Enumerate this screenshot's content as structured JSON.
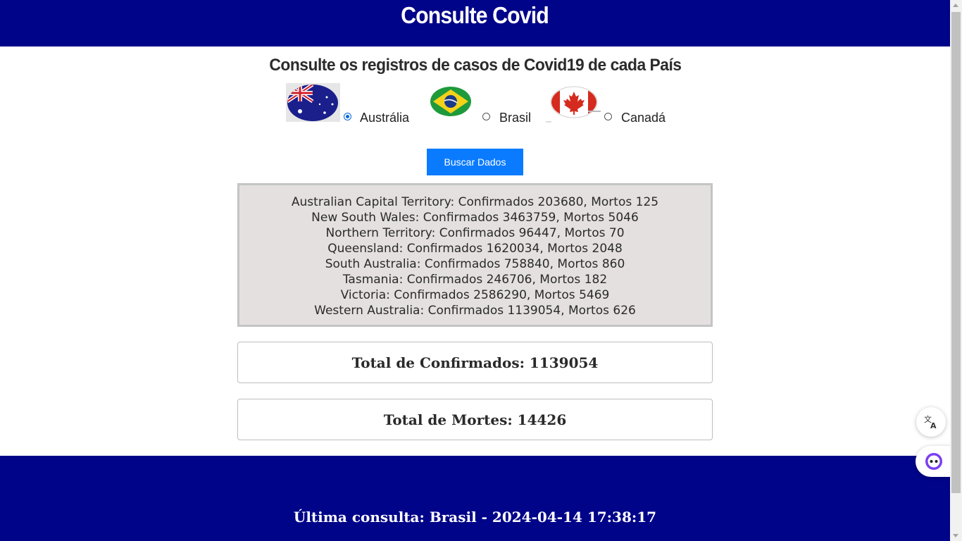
{
  "header": {
    "title": "Consulte Covid"
  },
  "subtitle": "Consulte os registros de casos de Covid19 de cada País",
  "countries": [
    {
      "label": "Austrália",
      "checked": true
    },
    {
      "label": "Brasil",
      "checked": false
    },
    {
      "label": "Canadá",
      "checked": false
    }
  ],
  "search_button": "Buscar Dados",
  "results": [
    "Australian Capital Territory: Confirmados 203680, Mortos 125",
    "New South Wales: Confirmados 3463759, Mortos 5046",
    "Northern Territory: Confirmados 96447, Mortos 70",
    "Queensland: Confirmados 1620034, Mortos 2048",
    "South Australia: Confirmados 758840, Mortos 860",
    "Tasmania: Confirmados 246706, Mortos 182",
    "Victoria: Confirmados 2586290, Mortos 5469",
    "Western Australia: Confirmados 1139054, Mortos 626"
  ],
  "totals": {
    "confirmed": "Total de Confirmados: 1139054",
    "deaths": "Total de Mortes: 14426"
  },
  "footer": {
    "last_query": "Última consulta: Brasil - 2024-04-14 17:38:17"
  },
  "colors": {
    "navy": "#000488",
    "button": "#0a7bff",
    "results_bg": "#e5e0e0"
  },
  "floating": [
    "translate-icon",
    "assistant-icon"
  ]
}
